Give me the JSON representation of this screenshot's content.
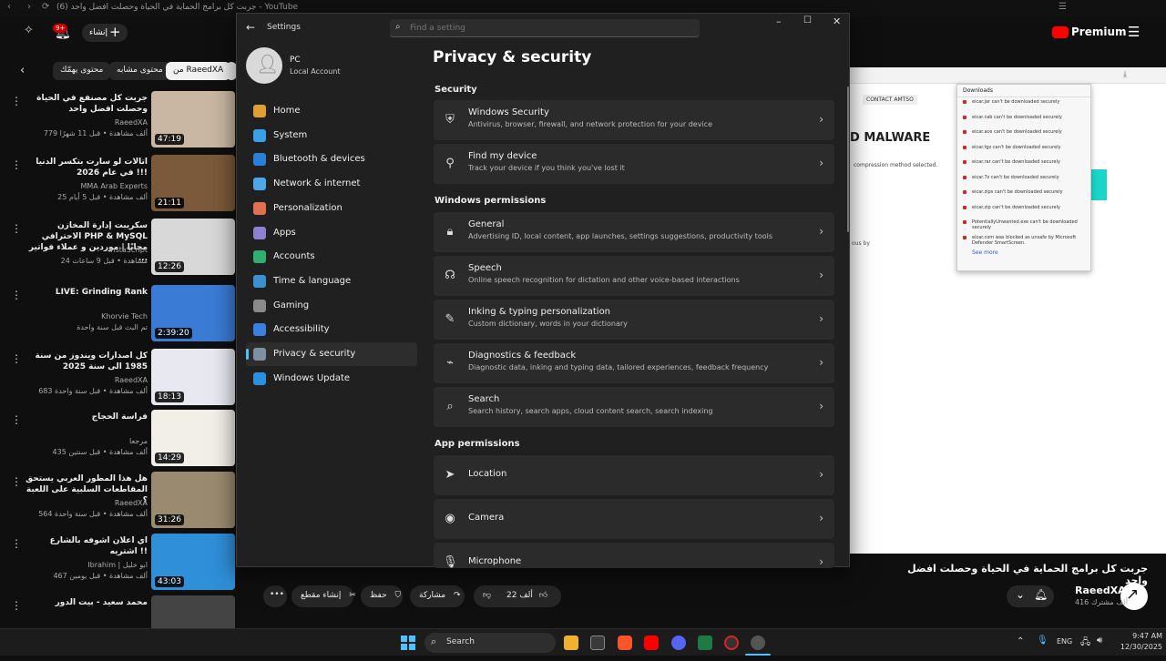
{
  "youtube": {
    "tab_title": "(6) جربت كل برامج الحماية في الحياة وحصلت افضل واحد - YouTube",
    "create_label": "إنشاء",
    "notif_count": "9+",
    "premium_label": "Premium",
    "chips": [
      "محتوى يهمّك",
      "محتوى مشابه",
      "من RaeedXA"
    ],
    "videos": [
      {
        "title": "جربت كل مصنفع في الحياة وحصلت افضل واحد",
        "channel": "RaeedXA",
        "meta": "779 ألف مشاهدة • قبل 11 شهرًا",
        "duration": "47:19",
        "thumb_color": "#c9b7a3"
      },
      {
        "title": "اتالات لو سارت بتكسر الدنيا في عام 2026 !!!",
        "channel": "MMA Arab Experts",
        "meta": "25 ألف مشاهدة • قبل 5 أيام",
        "duration": "21:11",
        "thumb_color": "#7a5a3a"
      },
      {
        "title": "سكريبت إدارة المخازن الاحترافي PHP & MySQL مجانًا | موردين و عملاء فواتير ...",
        "channel": "InstaScript",
        "meta": "24 مشاهدة • قبل 9 ساعات",
        "duration": "12:26",
        "thumb_color": "#d8d8d8"
      },
      {
        "title": "LIVE: Grinding Rank",
        "channel": "Khorvie Tech",
        "meta": "تم البث قبل سنة واحدة",
        "duration": "2:39:20",
        "thumb_color": "#3a7bd5"
      },
      {
        "title": "كل اصدارات ويندوز من سنة 1985 الى سنة 2025",
        "channel": "RaeedXA",
        "meta": "683 ألف مشاهدة • قبل سنة واحدة",
        "duration": "18:13",
        "thumb_color": "#e8e8f0"
      },
      {
        "title": "فراسة الحجاج",
        "channel": "مرجعا",
        "meta": "435 ألف مشاهدة • قبل سنتين",
        "duration": "14:29",
        "thumb_color": "#f2efe9"
      },
      {
        "title": "هل هذا المطور العربي يستحق المقاطعات السلبية على اللعبة ؟",
        "channel": "RaeedXA",
        "meta": "564 ألف مشاهدة • قبل سنة واحدة",
        "duration": "31:26",
        "thumb_color": "#9a8b70"
      },
      {
        "title": "اي اعلان اشوفه بالشارع اشتريه !!",
        "channel": "Ibrahim | ابو خليل",
        "meta": "467 ألف مشاهدة • قبل يومين",
        "duration": "43:03",
        "thumb_color": "#2f8fd8"
      },
      {
        "title": "محمد سعيد - بيت الدور",
        "channel": "",
        "meta": "",
        "duration": "",
        "thumb_color": "#444444"
      }
    ],
    "video_title": "جربت كل برامج الحماية في الحياة وحصلت افضل واحد",
    "channel_name": "RaeedXA",
    "subscribers": "416 ألف مشترك",
    "actions": {
      "like": "22 ألف",
      "share": "مشاركة",
      "save": "حفظ",
      "clip": "إنشاء مقطع"
    },
    "player": {
      "contact": "CONTACT AMTSO",
      "malware": "D MALWARE",
      "compression": "compression method selected.",
      "ous_by": "ous by",
      "downloads_title": "Downloads",
      "downloads": [
        "eicar.jar can't be downloaded securely",
        "eicar.cab can't be downloaded securely",
        "eicar.ace can't be downloaded securely",
        "eicar.tgz can't be downloaded securely",
        "eicar.rar can't be downloaded securely",
        "eicar.7z can't be downloaded securely",
        "eicar.zips can't be downloaded securely",
        "eicar.zip can't be downloaded securely",
        "PotentiallyUnwanted.exe can't be downloaded securely",
        "eicar.com was blocked as unsafe by Microsoft Defender SmartScreen."
      ],
      "see_more": "See more"
    }
  },
  "settings": {
    "app_title": "Settings",
    "search_placeholder": "Find a setting",
    "account": {
      "name": "PC",
      "type": "Local Account"
    },
    "nav": [
      {
        "label": "Home",
        "color": "#e0a030"
      },
      {
        "label": "System",
        "color": "#3aa0e8"
      },
      {
        "label": "Bluetooth & devices",
        "color": "#2a7fd8"
      },
      {
        "label": "Network & internet",
        "color": "#4aa8e8"
      },
      {
        "label": "Personalization",
        "color": "#e07050"
      },
      {
        "label": "Apps",
        "color": "#9080d0"
      },
      {
        "label": "Accounts",
        "color": "#30b070"
      },
      {
        "label": "Time & language",
        "color": "#3a90d0"
      },
      {
        "label": "Gaming",
        "color": "#8a8a8a"
      },
      {
        "label": "Accessibility",
        "color": "#3a80e0"
      },
      {
        "label": "Privacy & security",
        "color": "#8090a0"
      },
      {
        "label": "Windows Update",
        "color": "#2a90e0"
      }
    ],
    "page_title": "Privacy & security",
    "sections": {
      "security": "Security",
      "windows_permissions": "Windows permissions",
      "app_permissions": "App permissions"
    },
    "cards": [
      {
        "icon": "shield-icon",
        "glyph": "⛨",
        "title": "Windows Security",
        "desc": "Antivirus, browser, firewall, and network protection for your device"
      },
      {
        "icon": "person-location-icon",
        "glyph": "⚲",
        "title": "Find my device",
        "desc": "Track your device if you think you've lost it"
      },
      {
        "icon": "lock-icon",
        "glyph": "🔒︎",
        "title": "General",
        "desc": "Advertising ID, local content, app launches, settings suggestions, productivity tools"
      },
      {
        "icon": "speech-icon",
        "glyph": "☊",
        "title": "Speech",
        "desc": "Online speech recognition for dictation and other voice-based interactions"
      },
      {
        "icon": "inking-icon",
        "glyph": "✎",
        "title": "Inking & typing personalization",
        "desc": "Custom dictionary, words in your dictionary"
      },
      {
        "icon": "diagnostics-icon",
        "glyph": "⌁",
        "title": "Diagnostics & feedback",
        "desc": "Diagnostic data, inking and typing data, tailored experiences, feedback frequency"
      },
      {
        "icon": "search-icon",
        "glyph": "⌕",
        "title": "Search",
        "desc": "Search history, search apps, cloud content search, search indexing"
      },
      {
        "icon": "location-icon",
        "glyph": "➤",
        "title": "Location",
        "desc": ""
      },
      {
        "icon": "camera-icon",
        "glyph": "◉",
        "title": "Camera",
        "desc": ""
      },
      {
        "icon": "microphone-icon",
        "glyph": "🎙︎",
        "title": "Microphone",
        "desc": ""
      }
    ]
  },
  "taskbar": {
    "search_label": "Search",
    "lang": "ENG",
    "time": "9:47 AM",
    "date": "12/30/2025"
  },
  "colors": {
    "accent": "#4cc2ff",
    "youtube_red": "#ff0000"
  }
}
